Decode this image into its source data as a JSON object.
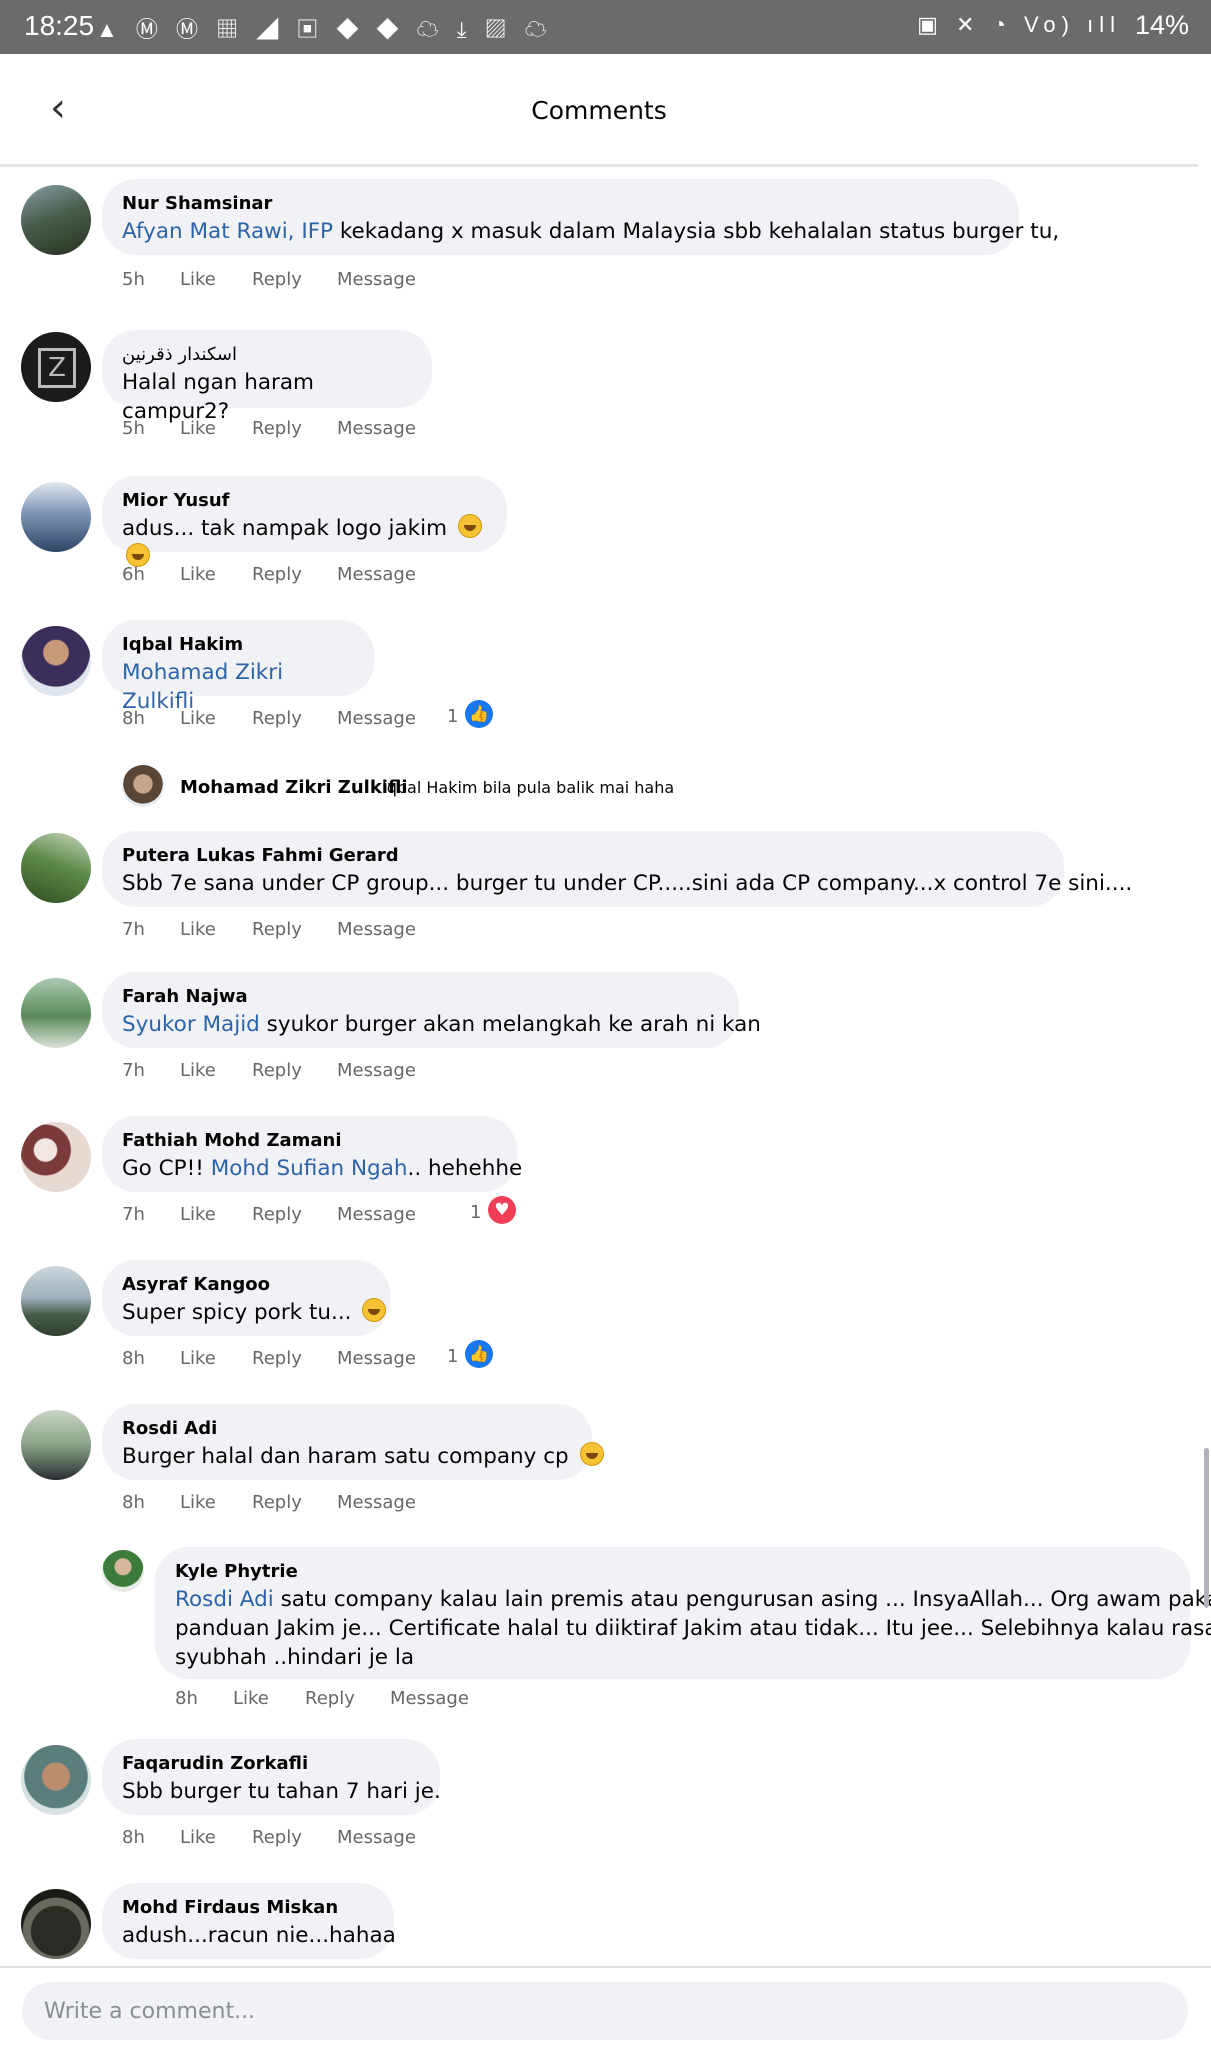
{
  "status_bar": {
    "time": "18:25",
    "left_icons": "▲ Ⓜ Ⓜ ▦ ◢ ▣ ◆ ◆ ☁ ⤓ ▨ ☁",
    "right_icons": "▣ ✕ ◔ Vo) ıll",
    "battery": "14%"
  },
  "header": {
    "back_icon": "‹",
    "title": "Comments"
  },
  "actions": {
    "like": "Like",
    "reply": "Reply",
    "message": "Message"
  },
  "comments": [
    {
      "author": "Nur Shamsinar",
      "mention": "Afyan Mat Rawi, IFP",
      "text": " kekadang x masuk dalam Malaysia sbb kehalalan status burger tu,",
      "time": "5h"
    },
    {
      "author": "اسكندار ذقرنين",
      "text": "Halal ngan haram campur2?",
      "time": "5h"
    },
    {
      "author": "Mior Yusuf",
      "text": "adus... tak nampak logo jakim ",
      "time": "6h"
    },
    {
      "author": "Iqbal Hakim",
      "mention": "Mohamad Zikri Zulkifli",
      "time": "8h",
      "reaction_count": "1"
    },
    {
      "author": "Putera Lukas Fahmi Gerard",
      "text": "Sbb 7e sana under CP group... burger tu under CP.....sini ada CP company...x control 7e sini....",
      "time": "7h"
    },
    {
      "author": "Farah Najwa",
      "mention": "Syukor Majid",
      "text": " syukor burger akan melangkah ke arah ni kan",
      "time": "7h"
    },
    {
      "author": "Fathiah Mohd Zamani",
      "pre": "Go CP!! ",
      "mention": "Mohd Sufian Ngah",
      "text": ".. hehehhe",
      "time": "7h",
      "reaction_count": "1"
    },
    {
      "author": "Asyraf Kangoo",
      "text": "Super spicy pork tu... ",
      "time": "8h",
      "reaction_count": "1"
    },
    {
      "author": "Rosdi Adi",
      "text": "Burger halal dan haram satu company cp ",
      "time": "8h"
    },
    {
      "author": "Kyle Phytrie",
      "mention": "Rosdi Adi",
      "line1": " satu company kalau lain premis atau pengurusan asing ... InsyaAllah... Org awam pakai",
      "line2": "panduan Jakim je... Certificate halal tu diiktiraf Jakim atau tidak... Itu jee... Selebihnya kalau rasa",
      "line3": "syubhah ..hindari je la",
      "time": "8h"
    },
    {
      "author": "Faqarudin Zorkafli",
      "text": "Sbb burger tu tahan 7 hari je.",
      "time": "8h"
    },
    {
      "author": "Mohd Firdaus Miskan",
      "text": "adush...racun nie...hahaa"
    }
  ],
  "collapsed_reply": {
    "author": "Mohamad Zikri Zulkifli",
    "text": "Iqbal Hakim bila pula balik mai haha"
  },
  "composer": {
    "placeholder": "Write a comment..."
  },
  "colors": {
    "bubble": "#f0f2f5",
    "mention": "#2d63a8",
    "like": "#1877f2",
    "love": "#f33e58",
    "status_bar": "#6b6b6b"
  }
}
